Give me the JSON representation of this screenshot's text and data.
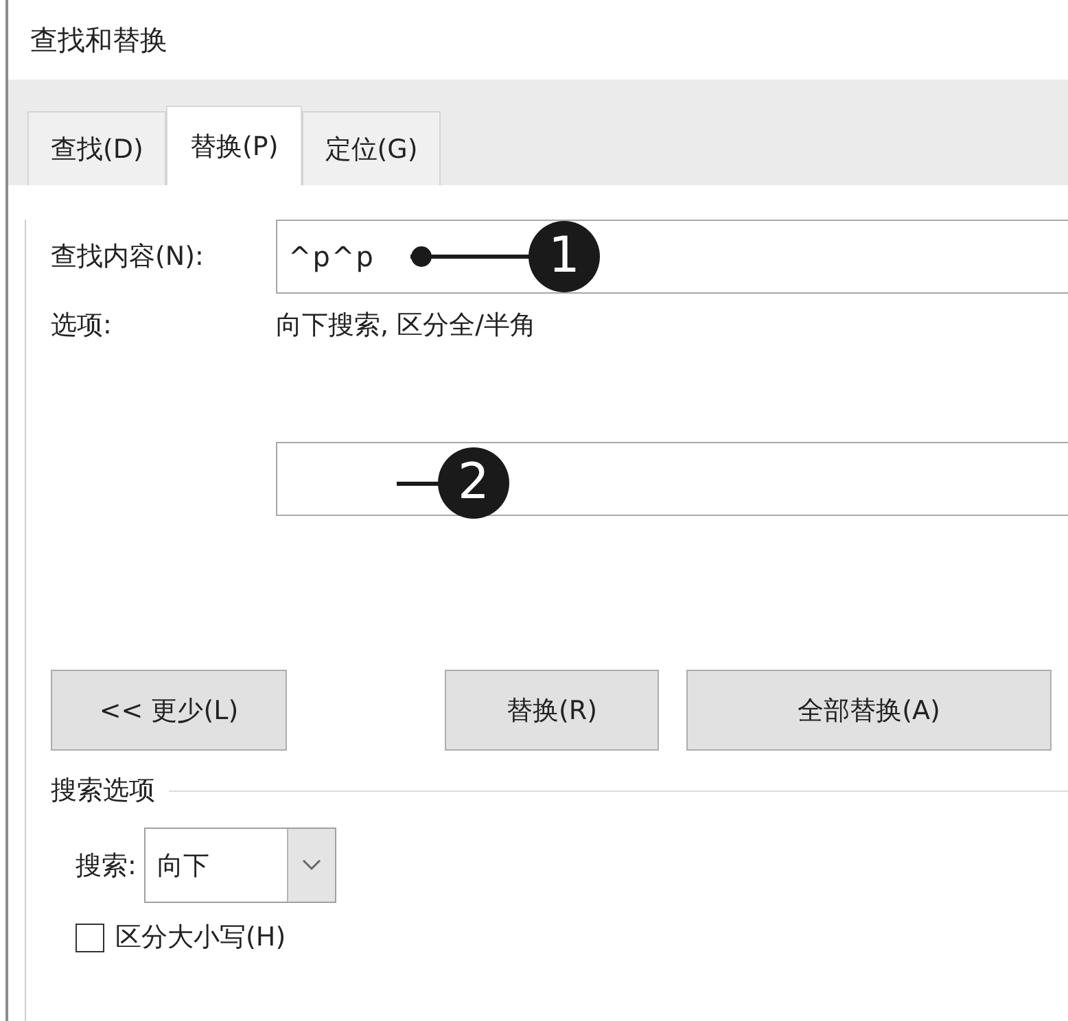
{
  "window": {
    "title": "查找和替换"
  },
  "tabs": [
    {
      "label": "查找(D)",
      "selected": false
    },
    {
      "label": "替换(P)",
      "selected": true
    },
    {
      "label": "定位(G)",
      "selected": false
    }
  ],
  "find": {
    "label": "查找内容(N):",
    "value": "^p^p"
  },
  "options": {
    "label": "选项:",
    "value": "向下搜索, 区分全/半角"
  },
  "callouts": [
    {
      "number": "1"
    },
    {
      "number": "2"
    }
  ],
  "buttons": [
    {
      "label": "<< 更少(L)"
    },
    {
      "label": "替换(R)"
    },
    {
      "label": "全部替换(A)"
    }
  ],
  "search_options": {
    "title": "搜索选项",
    "direction": {
      "label": "搜索:",
      "value": "向下"
    },
    "checkboxes": [
      {
        "label": "区分大小写(H)",
        "checked": false
      }
    ]
  }
}
